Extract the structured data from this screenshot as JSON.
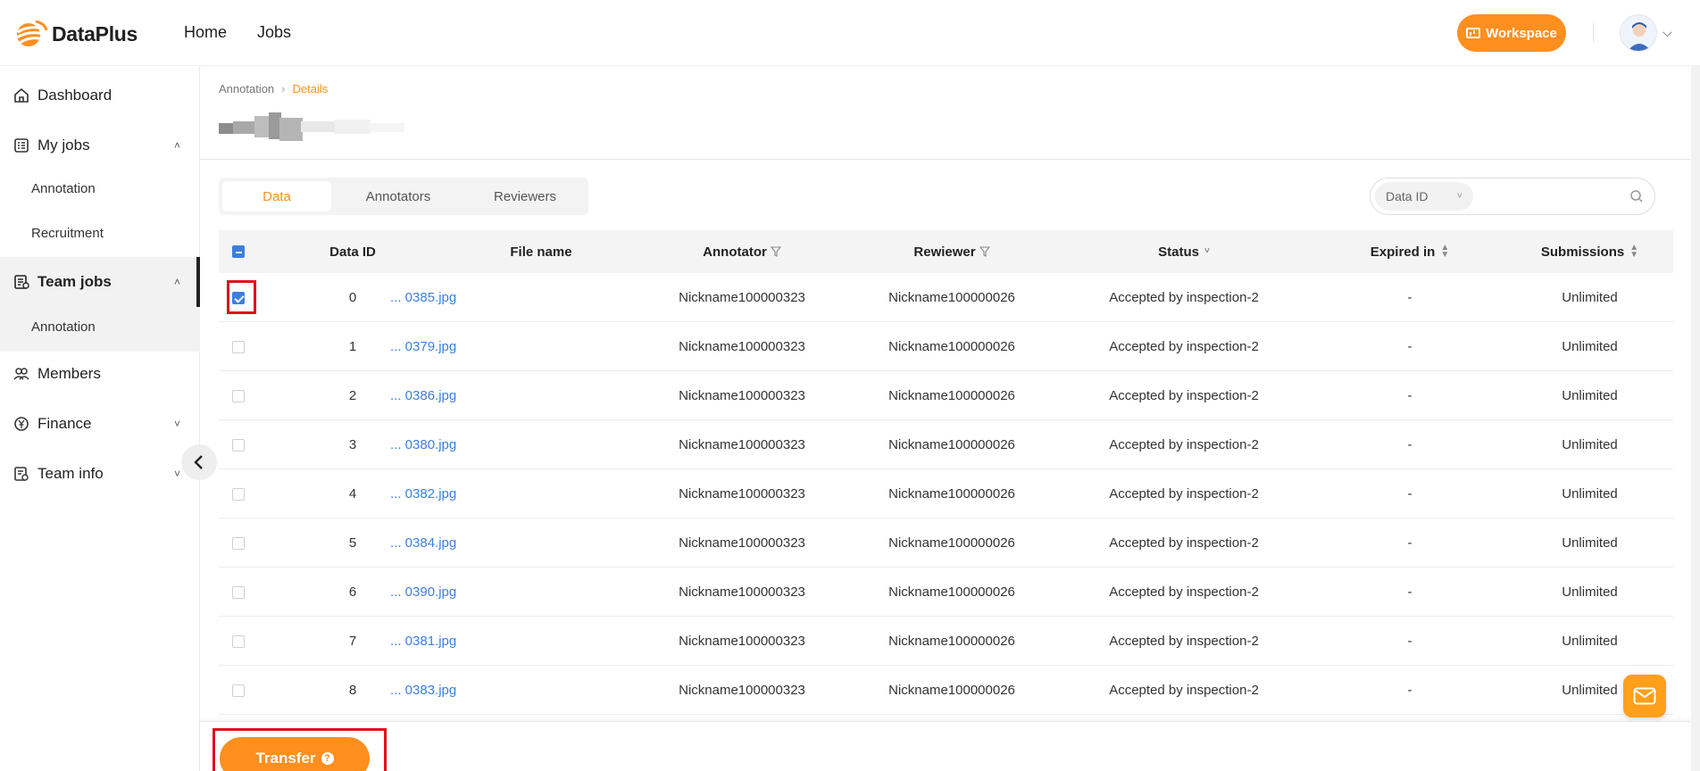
{
  "header": {
    "brand": "DataPlus",
    "nav": [
      {
        "label": "Home"
      },
      {
        "label": "Jobs"
      }
    ],
    "workspace_label": "Workspace"
  },
  "sidebar": {
    "items": [
      {
        "label": "Dashboard",
        "icon": "home-icon"
      },
      {
        "label": "My jobs",
        "icon": "jobs-list-icon"
      },
      {
        "label": "Annotation"
      },
      {
        "label": "Recruitment"
      },
      {
        "label": "Team jobs",
        "icon": "team-jobs-icon"
      },
      {
        "label": "Annotation"
      },
      {
        "label": "Members",
        "icon": "members-icon"
      },
      {
        "label": "Finance",
        "icon": "finance-icon"
      },
      {
        "label": "Team info",
        "icon": "team-info-icon"
      }
    ]
  },
  "breadcrumb": {
    "parent": "Annotation",
    "current": "Details"
  },
  "tabs": [
    {
      "label": "Data"
    },
    {
      "label": "Annotators"
    },
    {
      "label": "Reviewers"
    }
  ],
  "search": {
    "field": "Data ID",
    "placeholder": ""
  },
  "table": {
    "columns": [
      "Data ID",
      "File name",
      "Annotator",
      "Rewiewer",
      "Status",
      "Expired in",
      "Submissions"
    ],
    "rows": [
      {
        "id": "0",
        "file": "... 0385.jpg",
        "annotator": "Nickname100000323",
        "reviewer": "Nickname100000026",
        "status": "Accepted by inspection-2",
        "expired": "-",
        "submissions": "Unlimited",
        "checked": true
      },
      {
        "id": "1",
        "file": "... 0379.jpg",
        "annotator": "Nickname100000323",
        "reviewer": "Nickname100000026",
        "status": "Accepted by inspection-2",
        "expired": "-",
        "submissions": "Unlimited",
        "checked": false
      },
      {
        "id": "2",
        "file": "... 0386.jpg",
        "annotator": "Nickname100000323",
        "reviewer": "Nickname100000026",
        "status": "Accepted by inspection-2",
        "expired": "-",
        "submissions": "Unlimited",
        "checked": false
      },
      {
        "id": "3",
        "file": "... 0380.jpg",
        "annotator": "Nickname100000323",
        "reviewer": "Nickname100000026",
        "status": "Accepted by inspection-2",
        "expired": "-",
        "submissions": "Unlimited",
        "checked": false
      },
      {
        "id": "4",
        "file": "... 0382.jpg",
        "annotator": "Nickname100000323",
        "reviewer": "Nickname100000026",
        "status": "Accepted by inspection-2",
        "expired": "-",
        "submissions": "Unlimited",
        "checked": false
      },
      {
        "id": "5",
        "file": "... 0384.jpg",
        "annotator": "Nickname100000323",
        "reviewer": "Nickname100000026",
        "status": "Accepted by inspection-2",
        "expired": "-",
        "submissions": "Unlimited",
        "checked": false
      },
      {
        "id": "6",
        "file": "... 0390.jpg",
        "annotator": "Nickname100000323",
        "reviewer": "Nickname100000026",
        "status": "Accepted by inspection-2",
        "expired": "-",
        "submissions": "Unlimited",
        "checked": false
      },
      {
        "id": "7",
        "file": "... 0381.jpg",
        "annotator": "Nickname100000323",
        "reviewer": "Nickname100000026",
        "status": "Accepted by inspection-2",
        "expired": "-",
        "submissions": "Unlimited",
        "checked": false
      },
      {
        "id": "8",
        "file": "... 0383.jpg",
        "annotator": "Nickname100000323",
        "reviewer": "Nickname100000026",
        "status": "Accepted by inspection-2",
        "expired": "-",
        "submissions": "Unlimited",
        "checked": false
      }
    ]
  },
  "footer": {
    "transfer_label": "Transfer",
    "help_glyph": "?"
  },
  "colors": {
    "accent": "#ff8f1f",
    "link": "#3b7ee0",
    "highlight": "#e0101e"
  }
}
